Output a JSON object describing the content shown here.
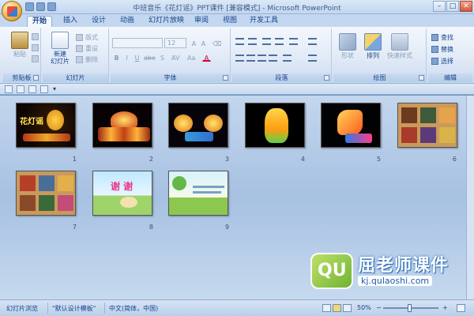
{
  "window": {
    "title": "中班音乐《花灯谣》PPT课件 [兼容模式] - Microsoft PowerPoint",
    "controls": [
      "–",
      "□",
      "✕"
    ]
  },
  "tabs": [
    "开始",
    "插入",
    "设计",
    "动画",
    "幻灯片放映",
    "审阅",
    "视图",
    "开发工具"
  ],
  "active_tab": "开始",
  "ribbon": {
    "clipboard": {
      "paste": "粘贴",
      "label": "剪贴板"
    },
    "slides": {
      "new_slide": "新建\n幻灯片",
      "layout": "版式",
      "reset": "重设",
      "delete": "删除",
      "label": "幻灯片"
    },
    "font": {
      "font_name": "",
      "font_size": "12",
      "bold": "B",
      "italic": "I",
      "underline": "U",
      "strike": "abe",
      "shadow": "S",
      "label": "字体"
    },
    "paragraph": {
      "label": "段落"
    },
    "drawing": {
      "shapes": "形状",
      "arrange": "排列",
      "quick_styles": "快速样式",
      "label": "绘图"
    },
    "editing": {
      "find": "查找",
      "replace": "替换",
      "select": "选择",
      "label": "编辑"
    }
  },
  "slides": [
    {
      "number": "1",
      "theme": "lantern-title",
      "text": "花灯谣"
    },
    {
      "number": "2",
      "theme": "lantern-night"
    },
    {
      "number": "3",
      "theme": "lantern-night"
    },
    {
      "number": "4",
      "theme": "tiger-lantern"
    },
    {
      "number": "5",
      "theme": "horse-lantern"
    },
    {
      "number": "6",
      "theme": "photo-grid"
    },
    {
      "number": "7",
      "theme": "photo-grid"
    },
    {
      "number": "8",
      "theme": "thanks",
      "text": "谢 谢"
    },
    {
      "number": "9",
      "theme": "cartoon"
    }
  ],
  "status": {
    "view": "幻灯片浏览",
    "template": "\"默认设计模板\"",
    "language": "中文(简体，中国)",
    "zoom": "50%"
  },
  "watermark": {
    "logo": "QU",
    "title": "屈老师课件",
    "url": "kj.qulaoshi.com"
  },
  "colors": {
    "ribbon_text": "#15428b",
    "sorter_bg": "#a7c1e2"
  }
}
